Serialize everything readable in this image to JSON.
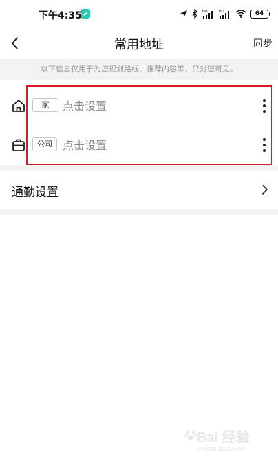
{
  "status_bar": {
    "time": "下午4:35",
    "battery": "64",
    "icons": [
      "location-arrow-icon",
      "bluetooth-icon",
      "hd-signal-icon",
      "hd-signal-icon",
      "wifi-icon",
      "battery-icon"
    ]
  },
  "nav": {
    "title": "常用地址",
    "sync_label": "同步",
    "back_icon": "chevron-left-icon"
  },
  "notice": "以下信息仅用于为您规划路线、推荐内容等，只对您可见。",
  "addresses": [
    {
      "icon": "home-icon",
      "tag": "家",
      "value": "点击设置"
    },
    {
      "icon": "briefcase-icon",
      "tag": "公司",
      "value": "点击设置"
    }
  ],
  "commute": {
    "label": "通勤设置",
    "chevron_icon": "chevron-right-icon"
  },
  "watermark": {
    "main": "Bai 经验",
    "sub": "jingyan.baidu.com"
  },
  "colors": {
    "highlight": "#d41c2a",
    "band": "#f3f3f3",
    "placeholder": "#8c8c8c",
    "app_icon": "#2ec4b6"
  }
}
